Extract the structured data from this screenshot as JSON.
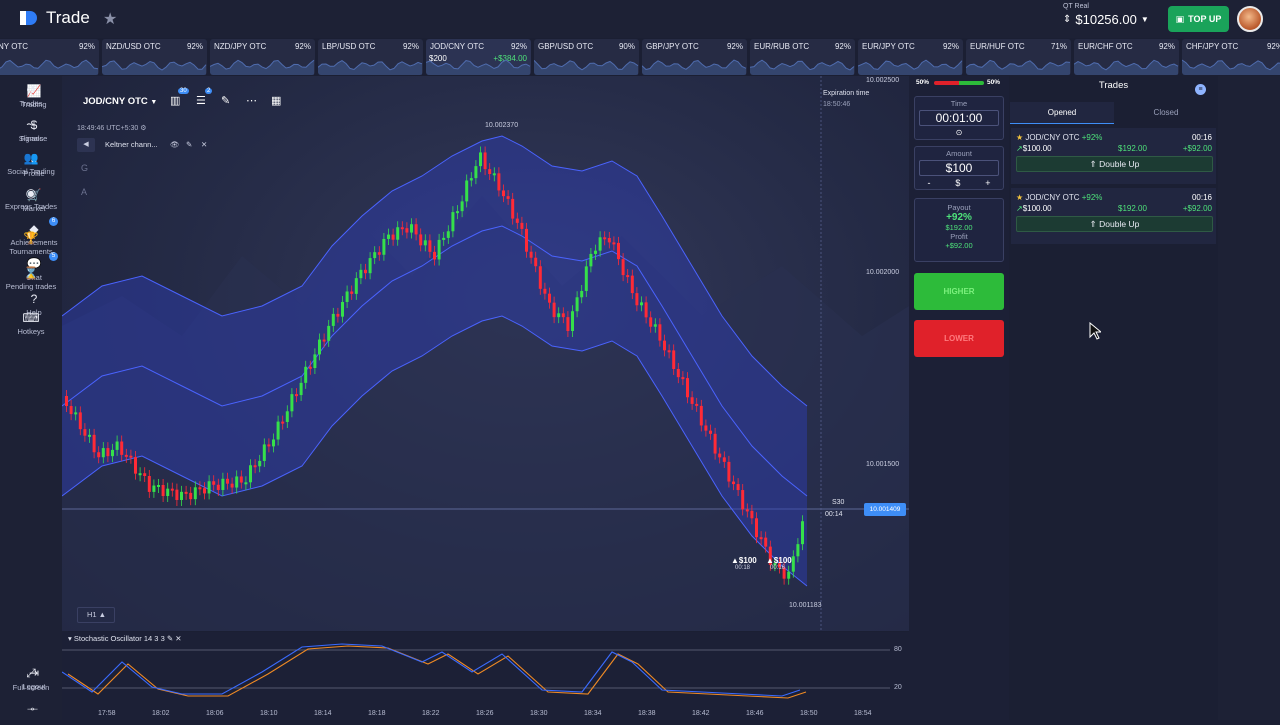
{
  "app": {
    "title": "Trade",
    "account_type": "QT Real",
    "balance": "$10256.00",
    "topup": "TOP UP"
  },
  "assets": [
    {
      "name": "NY OTC",
      "pct": "92%"
    },
    {
      "name": "NZD/USD OTC",
      "pct": "92%"
    },
    {
      "name": "NZD/JPY OTC",
      "pct": "92%"
    },
    {
      "name": "LBP/USD OTC",
      "pct": "92%"
    },
    {
      "name": "JOD/CNY OTC",
      "pct": "92%",
      "amount": "$200",
      "win": "+$384.00"
    },
    {
      "name": "GBP/USD OTC",
      "pct": "90%"
    },
    {
      "name": "GBP/JPY OTC",
      "pct": "92%"
    },
    {
      "name": "EUR/RUB OTC",
      "pct": "92%"
    },
    {
      "name": "EUR/JPY OTC",
      "pct": "92%"
    },
    {
      "name": "EUR/HUF OTC",
      "pct": "71%"
    },
    {
      "name": "EUR/CHF OTC",
      "pct": "92%"
    },
    {
      "name": "CHF/JPY OTC",
      "pct": "92%"
    }
  ],
  "leftnav": [
    {
      "label": "Trading",
      "icon": "chart-icon"
    },
    {
      "label": "Finance",
      "icon": "dollar-icon"
    },
    {
      "label": "Profile",
      "icon": "user-icon"
    },
    {
      "label": "Market",
      "icon": "cart-icon"
    },
    {
      "label": "Achievements",
      "icon": "diamond-icon",
      "badge": "6"
    },
    {
      "label": "Chat",
      "icon": "chat-icon",
      "badge": "5"
    },
    {
      "label": "Help",
      "icon": "help-icon"
    },
    {
      "label": "Logout",
      "icon": "logout-icon"
    }
  ],
  "chart_toolbar": {
    "pair": "JOD/CNY OTC",
    "badge1": "30",
    "badge2": "2",
    "time": "18:49:46 UTC+5:30",
    "indicator": "Keltner chann...",
    "tf": "H1",
    "side_g": "G",
    "side_a": "A"
  },
  "chart_labels": {
    "expiration": "Expiration time",
    "exp_time": "18:50:46",
    "high": "10.002370",
    "low": "10.001183",
    "current": "10.001409",
    "countdown_s": "S30",
    "countdown": "00:14",
    "bet1": "▲$100",
    "bet1_t": "00:18",
    "bet2": "▲$100",
    "bet2_t": "00:16"
  },
  "chart_data": {
    "type": "candlestick",
    "y_ticks": [
      "10.002500",
      "10.002000",
      "10.001500"
    ],
    "x_ticks": [
      "17:58",
      "18:02",
      "18:06",
      "18:10",
      "18:14",
      "18:18",
      "18:22",
      "18:26",
      "18:30",
      "18:34",
      "18:38",
      "18:42",
      "18:46",
      "18:50",
      "18:54"
    ],
    "current_price": 10.001409,
    "max_label": 10.00237,
    "min_label": 10.001183,
    "indicator": "Keltner channel"
  },
  "stochastic": {
    "title": "Stochastic Oscillator 14 3 3",
    "levels": [
      "80",
      "20"
    ]
  },
  "sentiment": {
    "left": "50%",
    "right": "50%"
  },
  "trade_panel": {
    "time_label": "Time",
    "time": "00:01:00",
    "amount_label": "Amount",
    "amount": "$100",
    "minus": "-",
    "currency": "$",
    "plus": "+",
    "payout_label": "Payout",
    "payout_pct": "+92%",
    "payout_amt": "$192.00",
    "profit_label": "Profit",
    "profit": "+$92.00",
    "higher": "HIGHER",
    "lower": "LOWER"
  },
  "trades": {
    "title": "Trades",
    "tab_open": "Opened",
    "tab_closed": "Closed",
    "items": [
      {
        "pair": "JOD/CNY OTC",
        "pct": "+92%",
        "time": "00:16",
        "amount": "$100.00",
        "payout": "$192.00",
        "profit": "+$92.00",
        "action": "Double Up"
      },
      {
        "pair": "JOD/CNY OTC",
        "pct": "+92%",
        "time": "00:16",
        "amount": "$100.00",
        "payout": "$192.00",
        "profit": "+$92.00",
        "action": "Double Up"
      }
    ]
  },
  "rightnav": [
    {
      "label": "Trades",
      "icon": "history-icon"
    },
    {
      "label": "Signals",
      "icon": "signal-icon"
    },
    {
      "label": "Social Trading",
      "icon": "social-icon"
    },
    {
      "label": "Express Trades",
      "icon": "express-icon"
    },
    {
      "label": "Tournaments",
      "icon": "trophy-icon"
    },
    {
      "label": "Pending trades",
      "icon": "hourglass-icon"
    },
    {
      "label": "Hotkeys",
      "icon": "keyboard-icon"
    },
    {
      "label": "Full screen",
      "icon": "fullscreen-icon"
    }
  ]
}
